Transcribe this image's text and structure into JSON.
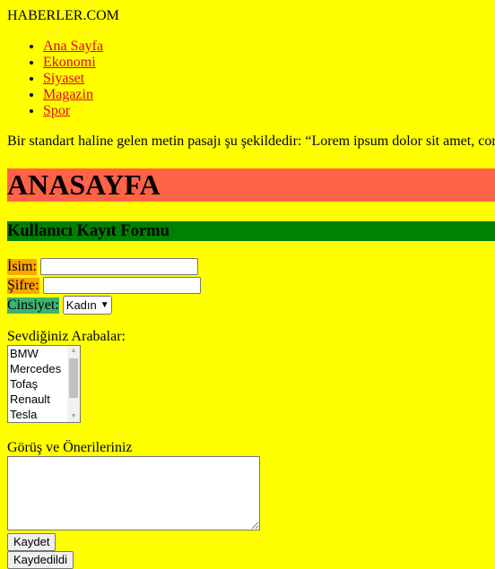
{
  "site": {
    "title": "HABERLER.COM"
  },
  "nav": {
    "items": [
      {
        "label": "Ana Sayfa"
      },
      {
        "label": "Ekonomi"
      },
      {
        "label": "Siyaset"
      },
      {
        "label": "Magazin"
      },
      {
        "label": "Spor"
      }
    ]
  },
  "intro": {
    "text": "Bir standart haline gelen metin pasajı şu şekildedir: “Lorem ipsum dolor sit amet, cor"
  },
  "hero": {
    "heading": "ANASAYFA"
  },
  "form": {
    "title": "Kullanıcı Kayıt Formu",
    "name_label": "İsim:",
    "name_value": "",
    "password_label": "Şifre:",
    "password_value": "",
    "gender_label": "Cinsiyet:",
    "gender_selected": "Kadın",
    "cars_label": "Sevdiğiniz Arabalar:",
    "cars_options": [
      "BMW",
      "Mercedes",
      "Tofaş",
      "Renault",
      "Tesla"
    ],
    "feedback_label": "Görüş ve Önerileriniz",
    "feedback_value": "",
    "save_button": "Kaydet",
    "saved_button": "Kaydedildi"
  },
  "colors": {
    "page_background": "#ffff00",
    "hero_background": "#ff6347",
    "form_title_background": "#008000",
    "label_orange": "#ffa500",
    "label_green": "#3cb371",
    "link": "#e4002b"
  }
}
